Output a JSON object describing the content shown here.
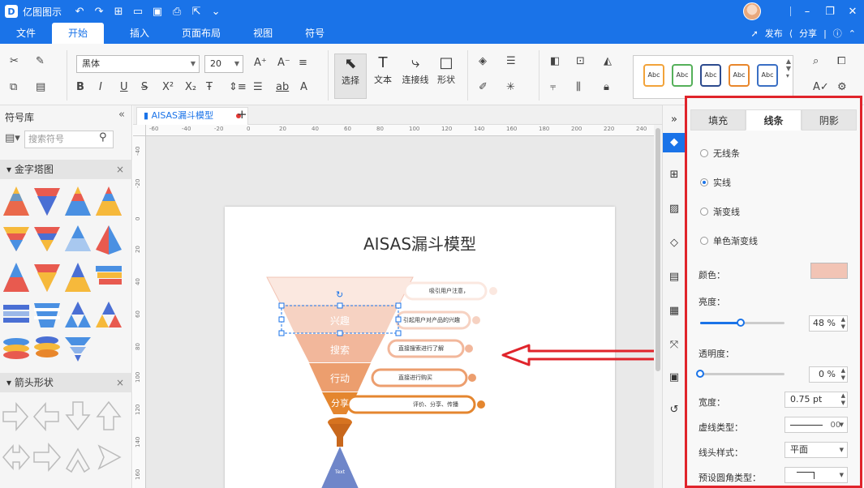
{
  "app": {
    "name": "亿图图示",
    "logo_letter": "D"
  },
  "menu": {
    "tabs": [
      "文件",
      "开始",
      "插入",
      "页面布局",
      "视图",
      "符号"
    ],
    "active": 1,
    "publish": "发布",
    "share": "分享"
  },
  "ribbon": {
    "font_name": "黑体",
    "font_size": "20",
    "tools": {
      "select": "选择",
      "text": "文本",
      "connector": "连接线",
      "shape": "形状"
    },
    "style_label": "Abc",
    "style_colors": [
      "#f2a33a",
      "#55b05a",
      "#2c4a8e",
      "#e8862b",
      "#3a6fc4"
    ]
  },
  "left_panel": {
    "title": "符号库",
    "search_placeholder": "搜索符号",
    "category_pyramid": "金字塔图",
    "category_arrow": "箭头形状",
    "close": "×"
  },
  "document": {
    "tab_name": "AISAS漏斗模型",
    "title": "AISAS漏斗模型",
    "ruler_h_labels": [
      "-60",
      "-40",
      "-20",
      "0",
      "20",
      "40",
      "60",
      "80",
      "100",
      "120",
      "140",
      "160",
      "180",
      "200",
      "220",
      "240"
    ],
    "ruler_v_labels": [
      "-40",
      "-20",
      "0",
      "20",
      "40",
      "60",
      "80",
      "100",
      "120",
      "140",
      "160"
    ],
    "funnel": [
      {
        "label": "",
        "desc": "吸引用户注意，",
        "color": "#fbe8e0"
      },
      {
        "label": "兴趣",
        "desc": "引起用户对产品的兴趣",
        "color": "#f6d2c2"
      },
      {
        "label": "搜索",
        "desc": "直接搜索进行了解",
        "color": "#f2b79b"
      },
      {
        "label": "行动",
        "desc": "直接进行购买",
        "color": "#ec9e6e"
      },
      {
        "label": "分享",
        "desc": "评价、分享、传播",
        "color": "#e4862f"
      }
    ],
    "bottom_label": "Text"
  },
  "properties": {
    "tabs": [
      "填充",
      "线条",
      "阴影"
    ],
    "active_tab": 1,
    "line_options": [
      "无线条",
      "实线",
      "渐变线",
      "单色渐变线"
    ],
    "selected_option": 1,
    "color_label": "颜色：",
    "line_color": "#f2c4b5",
    "brightness_label": "亮度：",
    "brightness_value": "48 %",
    "brightness_fraction": 0.48,
    "transparency_label": "透明度：",
    "transparency_value": "0 %",
    "transparency_fraction": 0,
    "width_label": "宽度：",
    "width_value": "0.75 pt",
    "dash_label": "虚线类型：",
    "dash_value": "00",
    "arrow_label": "线头样式：",
    "arrow_value": "平面",
    "corner_label": "预设圆角类型："
  },
  "colors": {
    "accent": "#1a73e8",
    "highlight_border": "#e0242b",
    "annotation_arrow": "#e0242b"
  }
}
